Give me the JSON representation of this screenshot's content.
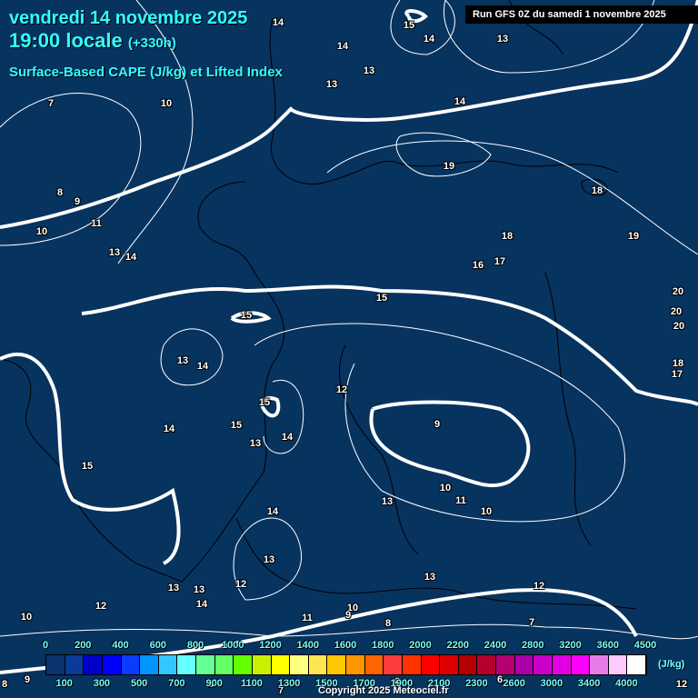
{
  "header": {
    "date": "vendredi 14 novembre 2025",
    "time": "19:00 locale",
    "lead": "(+330h)",
    "product": "Surface-Based CAPE (J/kg) et Lifted Index",
    "run": "Run GFS 0Z du samedi 1 novembre 2025"
  },
  "colors": {
    "background": "#07335f",
    "title": "#33ffff",
    "contour": "#ffffff",
    "coast": "#000000"
  },
  "contour_labels": [
    "14",
    "15",
    "14",
    "13",
    "14",
    "13",
    "13",
    "7",
    "10",
    "14",
    "19",
    "18",
    "8",
    "9",
    "11",
    "10",
    "19",
    "18",
    "13",
    "14",
    "17",
    "16",
    "15",
    "20",
    "15",
    "20",
    "20",
    "13",
    "14",
    "18",
    "17",
    "12",
    "15",
    "9",
    "15",
    "14",
    "14",
    "13",
    "15",
    "10",
    "11",
    "13",
    "10",
    "14",
    "13",
    "13",
    "12",
    "13",
    "13",
    "12",
    "14",
    "12",
    "10",
    "9",
    "11",
    "10",
    "8",
    "7",
    "8",
    "9",
    "9",
    "7",
    "6",
    "6",
    "12"
  ],
  "legend": {
    "unit": "(J/kg)",
    "top_labels": [
      "0",
      "200",
      "400",
      "600",
      "800",
      "1000",
      "1200",
      "1400",
      "1600",
      "1800",
      "2000",
      "2200",
      "2400",
      "2800",
      "3200",
      "3600",
      "4500"
    ],
    "bottom_labels": [
      "100",
      "300",
      "500",
      "700",
      "900",
      "1100",
      "1300",
      "1500",
      "1700",
      "1900",
      "2100",
      "2300",
      "2600",
      "3000",
      "3400",
      "4000"
    ],
    "swatches": [
      "#061445",
      "#0a3470",
      "#0a3a9a",
      "#0000c8",
      "#0000ff",
      "#0a3cff",
      "#0096ff",
      "#32c8ff",
      "#64ffff",
      "#64ff96",
      "#64ff64",
      "#64ff00",
      "#c8f000",
      "#ffff00",
      "#ffff80",
      "#ffe650",
      "#ffc800",
      "#ff9600",
      "#ff6400",
      "#ff3c3c",
      "#ff3200",
      "#ff0000",
      "#dc0000",
      "#b40000",
      "#b4002d",
      "#b40070",
      "#aa00aa",
      "#c800c8",
      "#e100e1",
      "#ff00ff",
      "#e67de6",
      "#ffc8ff",
      "#ffffff"
    ]
  },
  "copyright": "Copyright 2025 Meteociel.fr"
}
